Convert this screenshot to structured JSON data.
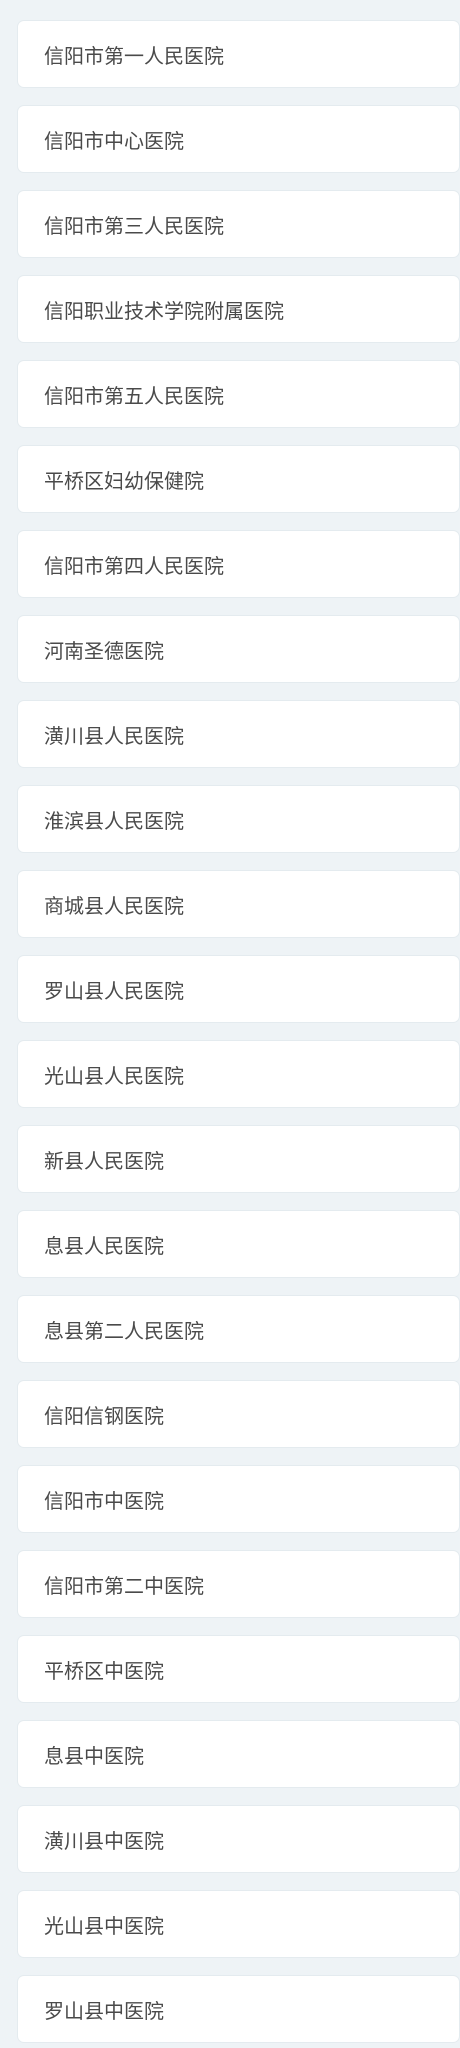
{
  "hospitals": [
    "信阳市第一人民医院",
    "信阳市中心医院",
    "信阳市第三人民医院",
    "信阳职业技术学院附属医院",
    "信阳市第五人民医院",
    "平桥区妇幼保健院",
    "信阳市第四人民医院",
    "河南圣德医院",
    "潢川县人民医院",
    "淮滨县人民医院",
    "商城县人民医院",
    "罗山县人民医院",
    "光山县人民医院",
    "新县人民医院",
    "息县人民医院",
    "息县第二人民医院",
    "信阳信钢医院",
    "信阳市中医院",
    "信阳市第二中医院",
    "平桥区中医院",
    "息县中医院",
    "潢川县中医院",
    "光山县中医院",
    "罗山县中医院"
  ]
}
